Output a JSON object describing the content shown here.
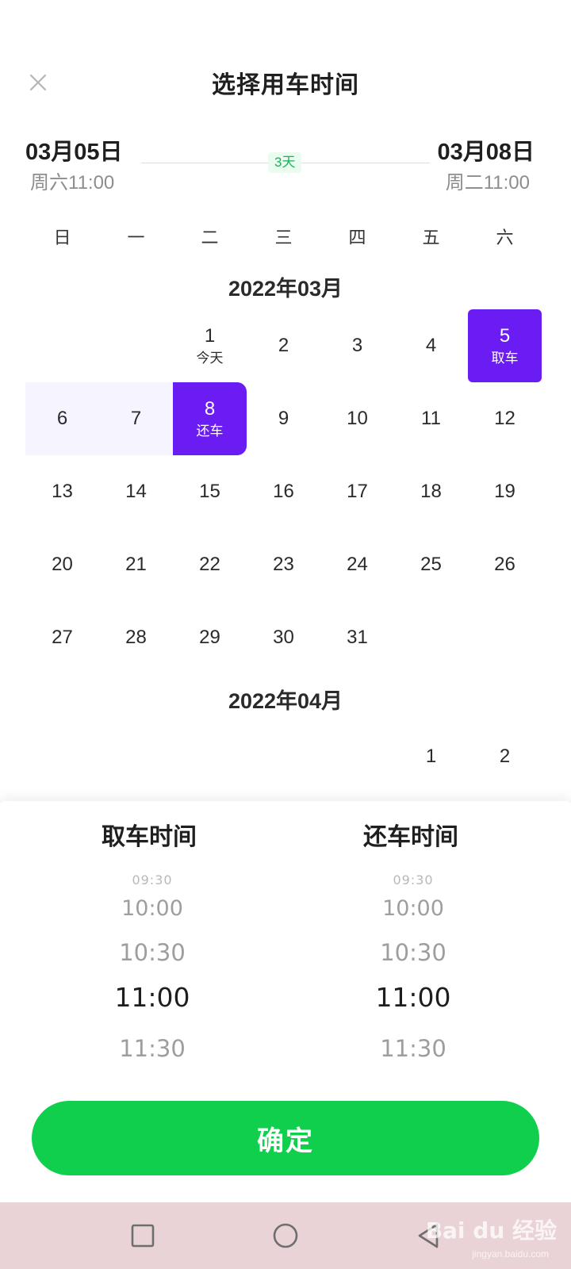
{
  "header": {
    "title": "选择用车时间",
    "close_icon": "close-icon"
  },
  "range": {
    "start_date": "03月05日",
    "start_time": "周六11:00",
    "end_date": "03月08日",
    "end_time": "周二11:00",
    "days": "3天"
  },
  "weekdays": [
    "日",
    "一",
    "二",
    "三",
    "四",
    "五",
    "六"
  ],
  "months": [
    {
      "title": "2022年03月",
      "offset": 2,
      "days": [
        {
          "n": "1",
          "sub": "今天"
        },
        {
          "n": "2"
        },
        {
          "n": "3"
        },
        {
          "n": "4"
        },
        {
          "n": "5",
          "sub": "取车",
          "state": "start"
        },
        {
          "n": "6",
          "state": "range"
        },
        {
          "n": "7",
          "state": "range"
        },
        {
          "n": "8",
          "sub": "还车",
          "state": "end"
        },
        {
          "n": "9"
        },
        {
          "n": "10"
        },
        {
          "n": "11"
        },
        {
          "n": "12"
        },
        {
          "n": "13"
        },
        {
          "n": "14"
        },
        {
          "n": "15"
        },
        {
          "n": "16"
        },
        {
          "n": "17"
        },
        {
          "n": "18"
        },
        {
          "n": "19"
        },
        {
          "n": "20"
        },
        {
          "n": "21"
        },
        {
          "n": "22"
        },
        {
          "n": "23"
        },
        {
          "n": "24"
        },
        {
          "n": "25"
        },
        {
          "n": "26"
        },
        {
          "n": "27"
        },
        {
          "n": "28"
        },
        {
          "n": "29"
        },
        {
          "n": "30"
        },
        {
          "n": "31"
        }
      ]
    },
    {
      "title": "2022年04月",
      "offset": 5,
      "days": [
        {
          "n": "1"
        },
        {
          "n": "2"
        }
      ]
    }
  ],
  "pickup": {
    "label": "取车时间",
    "options": [
      "09:30",
      "10:00",
      "10:30",
      "11:00",
      "11:30"
    ]
  },
  "return": {
    "label": "还车时间",
    "options": [
      "09:30",
      "10:00",
      "10:30",
      "11:00",
      "11:30"
    ]
  },
  "confirm_label": "确定",
  "colors": {
    "accent_purple": "#6a1cf2",
    "range_bg": "#f6f4fe",
    "confirm_green": "#10cf4c",
    "days_green": "#17b557",
    "nav_bg": "#ead3d7"
  },
  "watermark": {
    "brand": "Bai du 经验",
    "url": "jingyan.baidu.com"
  }
}
